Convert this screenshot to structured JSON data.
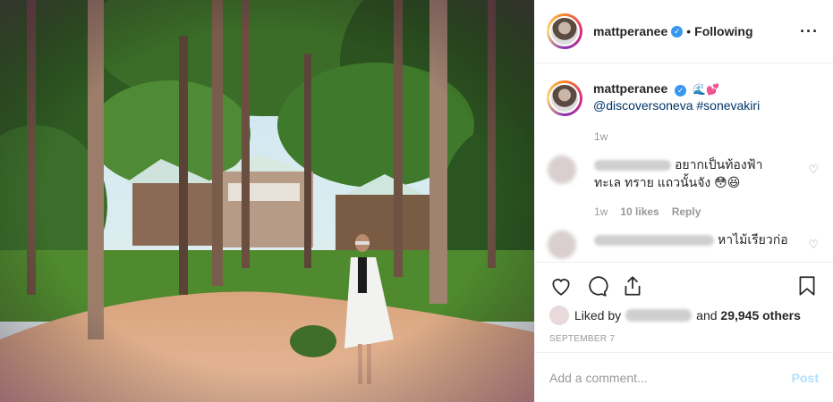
{
  "post": {
    "username": "mattperanee",
    "follow_status": "Following",
    "more_icon": "more-options-icon"
  },
  "caption": {
    "username": "mattperanee",
    "emoji": "🌊💕",
    "text": "@discoversoneva #sonevakiri",
    "time": "1w"
  },
  "comments": [
    {
      "text": "อยากเป็นท้องฟ้า ทะเล ทราย แถวนั้นจัง 😳😆",
      "time": "1w",
      "likes": "10 likes",
      "reply": "Reply"
    },
    {
      "text": "หาไม้เรียวก่อ"
    }
  ],
  "likes": {
    "prefix": "Liked by",
    "connector": "and",
    "others": "29,945 others"
  },
  "date": "SEPTEMBER 7",
  "add_comment": {
    "placeholder": "Add a comment...",
    "post_label": "Post"
  },
  "colors": {
    "verified": "#3897f0",
    "post_disabled": "#b2dffc",
    "caption_link": "#003569"
  }
}
